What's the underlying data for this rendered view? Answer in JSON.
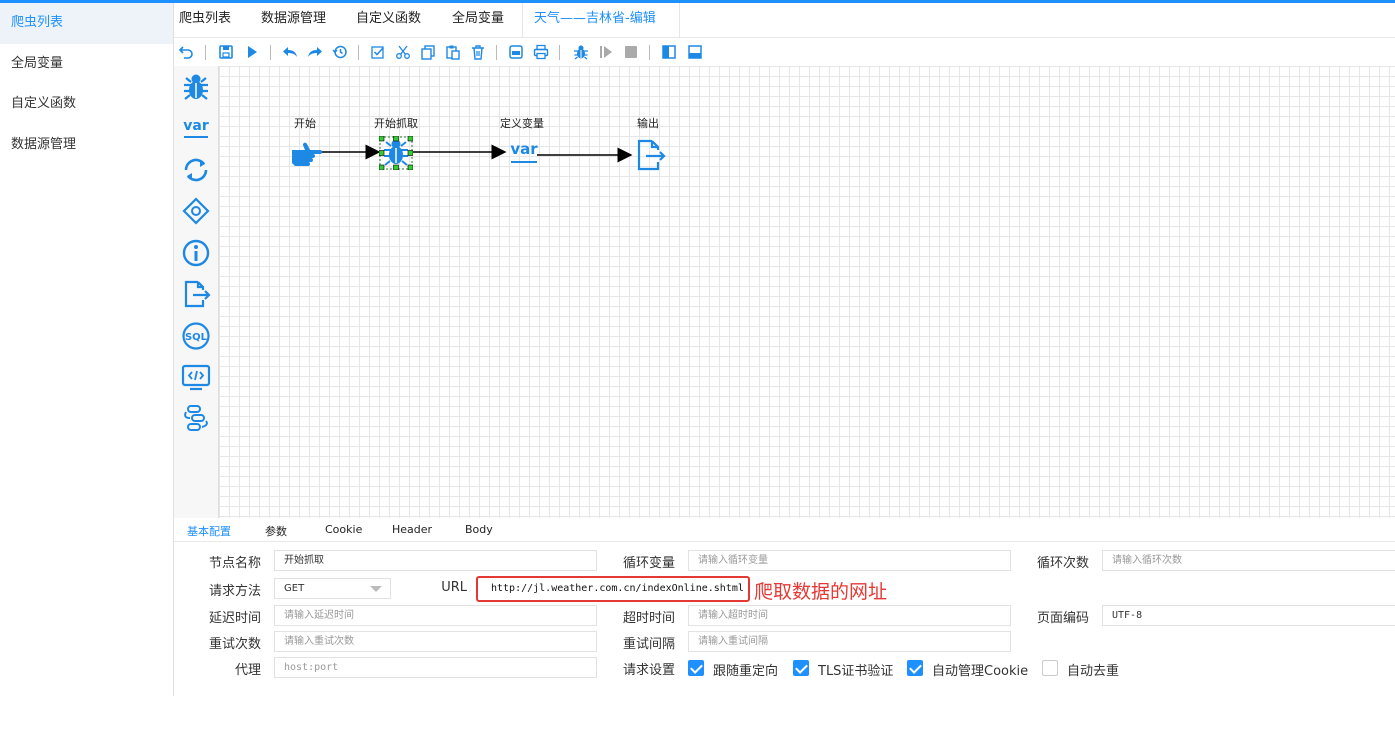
{
  "left_nav": {
    "items": [
      {
        "label": "爬虫列表",
        "active": true
      },
      {
        "label": "全局变量",
        "active": false
      },
      {
        "label": "自定义函数",
        "active": false
      },
      {
        "label": "数据源管理",
        "active": false
      }
    ]
  },
  "top_tabs": [
    {
      "label": "爬虫列表"
    },
    {
      "label": "数据源管理"
    },
    {
      "label": "自定义函数"
    },
    {
      "label": "全局变量"
    },
    {
      "label": "天气——吉林省-编辑",
      "active": true
    }
  ],
  "toolbar": {
    "icons": [
      "undo-icon",
      "save-icon",
      "run-icon",
      "undo-arrow-icon",
      "redo-arrow-icon",
      "history-icon",
      "select-all-icon",
      "cut-icon",
      "copy-icon",
      "paste-icon",
      "delete-icon",
      "export-icon",
      "print-icon",
      "debug-icon",
      "step-icon",
      "stop-icon",
      "panel-left-icon",
      "panel-bottom-icon"
    ]
  },
  "palette": {
    "icons": [
      "spider-icon",
      "var-icon",
      "loop-icon",
      "condition-icon",
      "info-icon",
      "output-icon",
      "sql-icon",
      "code-icon",
      "link-icon"
    ],
    "var_text": "var",
    "sql_text": "SQL"
  },
  "flow": {
    "nodes": [
      {
        "label": "开始",
        "icon": "hand-point-icon"
      },
      {
        "label": "开始抓取",
        "icon": "spider-icon",
        "selected": true
      },
      {
        "label": "定义变量",
        "icon": "var-icon",
        "icon_text": "var"
      },
      {
        "label": "输出",
        "icon": "output-icon"
      }
    ]
  },
  "panel_tabs": [
    {
      "label": "基本配置",
      "active": true
    },
    {
      "label": "参数"
    },
    {
      "label": "Cookie"
    },
    {
      "label": "Header"
    },
    {
      "label": "Body"
    }
  ],
  "form": {
    "node_name": {
      "label": "节点名称",
      "value": "开始抓取"
    },
    "loop_var": {
      "label": "循环变量",
      "placeholder": "请输入循环变量"
    },
    "loop_count": {
      "label": "循环次数",
      "placeholder": "请输入循环次数"
    },
    "method": {
      "label": "请求方法",
      "value": "GET"
    },
    "url": {
      "label": "URL",
      "value": "http://jl.weather.com.cn/indexOnline.shtml"
    },
    "annotation": "爬取数据的网址",
    "delay": {
      "label": "延迟时间",
      "placeholder": "请输入延迟时间"
    },
    "timeout": {
      "label": "超时时间",
      "placeholder": "请输入超时时间"
    },
    "encoding": {
      "label": "页面编码",
      "value": "UTF-8"
    },
    "retry_count": {
      "label": "重试次数",
      "placeholder": "请输入重试次数"
    },
    "retry_interval": {
      "label": "重试间隔",
      "placeholder": "请输入重试间隔"
    },
    "proxy": {
      "label": "代理",
      "placeholder": "host:port"
    },
    "request_settings": {
      "label": "请求设置",
      "options": [
        {
          "label": "跟随重定向",
          "checked": true
        },
        {
          "label": "TLS证书验证",
          "checked": true
        },
        {
          "label": "自动管理Cookie",
          "checked": true
        },
        {
          "label": "自动去重",
          "checked": false
        }
      ]
    }
  },
  "colors": {
    "accent": "#1e90ff",
    "annotation": "#e53935"
  }
}
